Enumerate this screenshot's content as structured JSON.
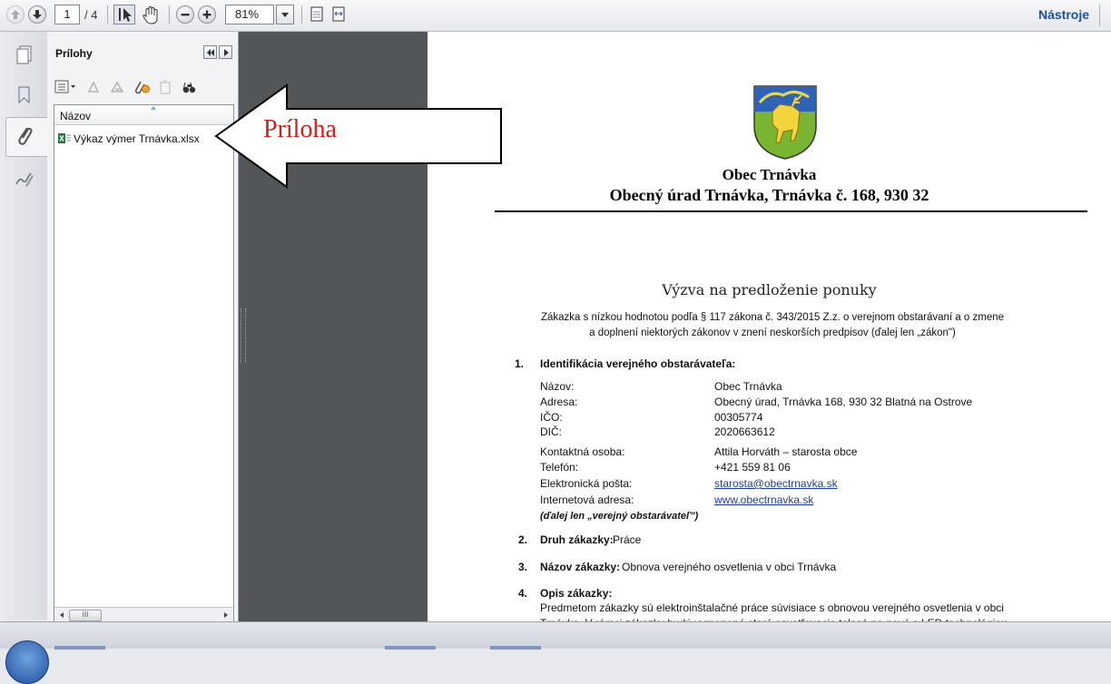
{
  "toolbar": {
    "page_current": "1",
    "page_total": "/ 4",
    "zoom": "81%",
    "tools_label": "Nástroje"
  },
  "attachments_panel": {
    "title": "Prílohy",
    "column_header": "Názov",
    "items": [
      {
        "label": "Výkaz výmer Trnávka.xlsx",
        "icon": "excel-file-icon"
      }
    ],
    "scroll_thumb": "III"
  },
  "annotation": {
    "label": "Príloha"
  },
  "document": {
    "org_name": "Obec Trnávka",
    "org_address": "Obecný úrad Trnávka, Trnávka č. 168, 930 32",
    "title": "Výzva na predloženie ponuky",
    "subtitle_line1": "Zákazka s nízkou hodnotou podľa § 117 zákona č. 343/2015 Z.z. o verejnom obstarávaní a o zmene",
    "subtitle_line2": "a doplnení niektorých zákonov v znení neskorších predpisov (ďalej len „zákon\")",
    "section1": {
      "num": "1.",
      "title": "Identifikácia verejného obstarávateľa:",
      "rows": [
        {
          "key": "Názov:",
          "value": "Obec Trnávka"
        },
        {
          "key": "Adresa:",
          "value": "Obecný úrad, Trnávka 168, 930 32 Blatná na Ostrove"
        },
        {
          "key": "IČO:",
          "value": "00305774"
        },
        {
          "key": "DIČ:",
          "value": "2020663612"
        },
        {
          "key": "Kontaktná osoba:",
          "value": "Attila Horváth – starosta obce"
        },
        {
          "key": "Telefón:",
          "value": "+421 559 81 06"
        },
        {
          "key": "Elektronická pošta:",
          "value": "starosta@obectrnavka.sk"
        },
        {
          "key": "Internetová adresa:",
          "value": "www.obectrnavka.sk"
        }
      ],
      "note": "(ďalej len „verejný obstarávateľ\")"
    },
    "section2": {
      "num": "2.",
      "title": "Druh zákazky:",
      "value": "Práce"
    },
    "section3": {
      "num": "3.",
      "title": "Názov zákazky:",
      "value": "Obnova verejného osvetlenia v obci Trnávka"
    },
    "section4": {
      "num": "4.",
      "title": "Opis zákazky:",
      "line1": "Predmetom zákazky sú elektroinštalačné práce súvisiace s obnovou verejného osvetlenia v obci",
      "line2": "Trnávka. V rámci zákazky budú vymenené staré osvetľovacie telesá na nové s LED technológiou"
    }
  },
  "colors": {
    "link": "#1f3da0",
    "annotation_text": "#d0201c",
    "page_bg": "#525659"
  }
}
